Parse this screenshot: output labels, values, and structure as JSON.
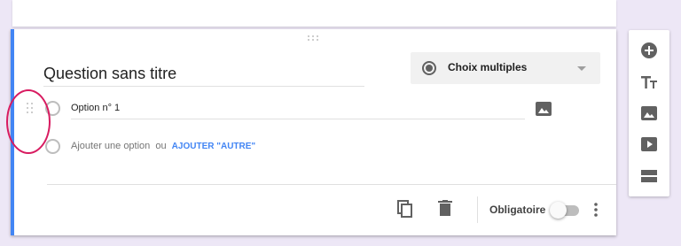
{
  "question": {
    "title": "Question sans titre",
    "type_label": "Choix multiples"
  },
  "options": {
    "first_option": "Option n° 1",
    "add_option": "Ajouter une option",
    "or_text": "ou",
    "add_other": "AJOUTER \"AUTRE\""
  },
  "footer": {
    "required_label": "Obligatoire",
    "required_on": false
  },
  "toolbar": {
    "items": [
      "add-question-icon",
      "add-title-icon",
      "add-image-icon",
      "add-video-icon",
      "add-section-icon"
    ]
  },
  "colors": {
    "accent": "#4285f4",
    "annotation": "#d81b60",
    "background": "#ede7f6"
  }
}
